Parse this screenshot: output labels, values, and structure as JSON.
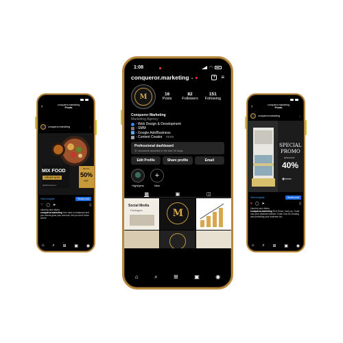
{
  "left_phone": {
    "time": "",
    "header_username": "conqueror.marketing",
    "header_section": "Posts",
    "post_user": "conqueror.marketing",
    "food_title": "MIX FOOD",
    "order_label": "ORDER NOW",
    "discount_prefix": "UP TO",
    "discount": "50%",
    "discount_suffix": "OFF",
    "handle": "@allrestaurant",
    "insights": "View insights",
    "boost": "Boost post",
    "liked_by": "Liked by and others",
    "caption_user": "conqueror.marketing",
    "caption": "Your have a restaurant and you wanna grow your account, but you don't know where"
  },
  "right_phone": {
    "header_username": "conqueror.marketing",
    "header_section": "Posts",
    "post_user": "conqueror.marketing",
    "promo_special": "SPECIAL",
    "promo_word": "PROMO",
    "promo_discount": "40%",
    "promo_sub": "DISCOUNT",
    "insights": "View insights",
    "boost": "Boost post",
    "liked_by": "Liked by and others",
    "caption_user": "conqueror.marketing",
    "caption": "First Times, hurry up. Order now your dreamed kitchen. Order now for creating and promoting your business too."
  },
  "profile": {
    "time": "1:08",
    "username": "conqueror.marketing",
    "stats": [
      {
        "value": "16",
        "label": "Posts"
      },
      {
        "value": "82",
        "label": "Followers"
      },
      {
        "value": "151",
        "label": "Following"
      }
    ],
    "display_name": "Conqueror Marketing",
    "category": "Marketing Agency",
    "bio_lines": [
      "- Web Design & Development",
      "- SMM",
      "- Google Ads/Business",
      "- Content Creator"
    ],
    "more": "more",
    "dashboard_title": "Professional dashboard",
    "dashboard_sub": "37 accounts reached in the last 30 days.",
    "buttons": [
      "Edit Profile",
      "Share profile",
      "Email"
    ],
    "highlights": [
      {
        "label": "Highlights"
      },
      {
        "label": "New"
      }
    ],
    "grid_texts": {
      "social_media": "Social Media",
      "packages": "Packages"
    }
  },
  "colors": {
    "gold": "#c79a3a",
    "phone_frame": "#b9883f",
    "side_button": "#c8cc2a",
    "boost_blue": "#1f6feb"
  }
}
